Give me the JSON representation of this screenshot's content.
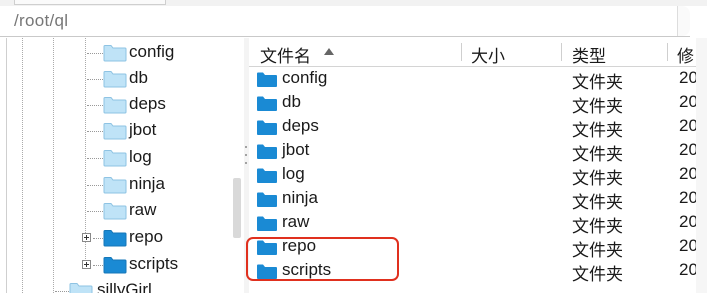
{
  "path_bar": {
    "path": "/root/ql"
  },
  "tree": {
    "items": [
      {
        "label": "config",
        "expandable": false
      },
      {
        "label": "db",
        "expandable": false
      },
      {
        "label": "deps",
        "expandable": false
      },
      {
        "label": "jbot",
        "expandable": false
      },
      {
        "label": "log",
        "expandable": false
      },
      {
        "label": "ninja",
        "expandable": false
      },
      {
        "label": "raw",
        "expandable": false
      },
      {
        "label": "repo",
        "expandable": true
      },
      {
        "label": "scripts",
        "expandable": true
      }
    ],
    "sibling_label": "sillyGirl"
  },
  "file_list": {
    "columns": {
      "name": "文件名",
      "size": "大小",
      "type": "类型",
      "modified": "修"
    },
    "sort": {
      "column": "name",
      "direction": "ascending"
    },
    "rows": [
      {
        "name": "config",
        "type": "文件夹",
        "modified": "20"
      },
      {
        "name": "db",
        "type": "文件夹",
        "modified": "20"
      },
      {
        "name": "deps",
        "type": "文件夹",
        "modified": "20"
      },
      {
        "name": "jbot",
        "type": "文件夹",
        "modified": "20"
      },
      {
        "name": "log",
        "type": "文件夹",
        "modified": "20"
      },
      {
        "name": "ninja",
        "type": "文件夹",
        "modified": "20"
      },
      {
        "name": "raw",
        "type": "文件夹",
        "modified": "20"
      },
      {
        "name": "repo",
        "type": "文件夹",
        "modified": "20"
      },
      {
        "name": "scripts",
        "type": "文件夹",
        "modified": "20"
      }
    ]
  },
  "colors": {
    "folder_light": "#bfe3f7",
    "folder_dark": "#1a8ad4",
    "highlight_border": "#e0301e"
  },
  "icons": {
    "folder": "folder-icon",
    "expander": "plus-expander-icon",
    "sort": "sort-ascending-icon"
  }
}
